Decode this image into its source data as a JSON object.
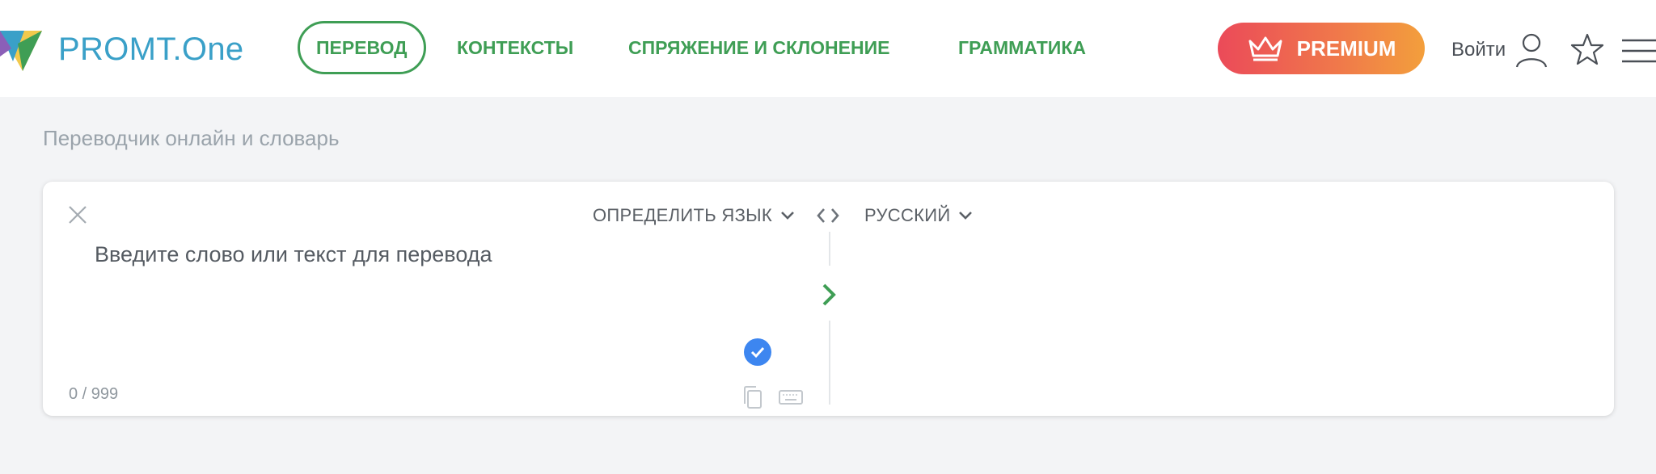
{
  "brand": {
    "name": "PROMT.One"
  },
  "nav": {
    "items": [
      {
        "label": "ПЕРЕВОД",
        "active": true
      },
      {
        "label": "КОНТЕКСТЫ",
        "active": false
      },
      {
        "label": "СПРЯЖЕНИЕ И СКЛОНЕНИЕ",
        "active": false
      },
      {
        "label": "ГРАММАТИКА",
        "active": false
      }
    ]
  },
  "header": {
    "premium_label": "PREMIUM",
    "login_label": "Войти",
    "icons": [
      "crown-icon",
      "user-icon",
      "star-icon",
      "menu-icon"
    ]
  },
  "page": {
    "subtitle": "Переводчик онлайн и словарь"
  },
  "translator": {
    "source_language": "ОПРЕДЕЛИТЬ ЯЗЫК",
    "target_language": "РУССКИЙ",
    "input_placeholder": "Введите слово или текст для перевода",
    "input_value": "",
    "char_counter": "0 / 999",
    "icons": [
      "close-icon",
      "swap-icon",
      "chevron-right-icon",
      "check-icon",
      "copy-icon",
      "keyboard-icon"
    ]
  },
  "colors": {
    "brand_green": "#3f9e55",
    "logo_blue": "#3aa0c8",
    "premium_start": "#eb4a59",
    "premium_end": "#f39f3c",
    "check_blue": "#3d86f0",
    "background": "#f3f4f6"
  }
}
